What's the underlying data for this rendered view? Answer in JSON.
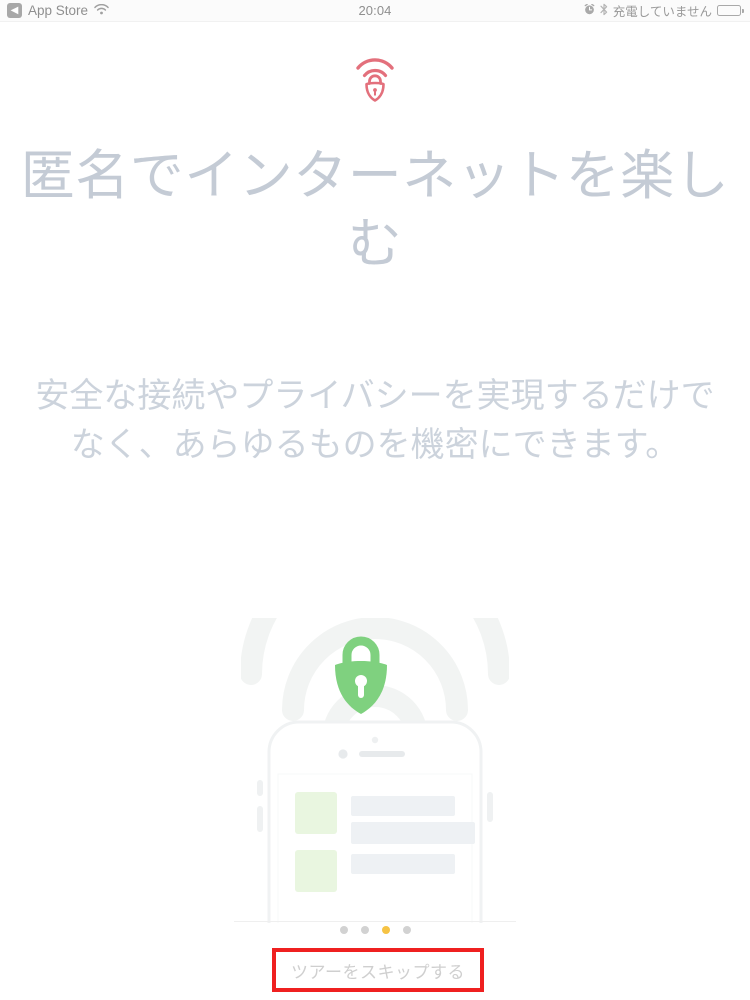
{
  "status_bar": {
    "back_label": "App Store",
    "back_icon": "chevron-left-icon",
    "wifi_icon": "wifi-icon",
    "time": "20:04",
    "alarm_icon": "alarm-clock-icon",
    "bluetooth_icon": "bluetooth-icon",
    "battery_text": "充電していません",
    "battery_icon": "battery-icon"
  },
  "brand": {
    "logo_icon": "wifi-lock-logo-icon",
    "logo_color": "#e3707c"
  },
  "content": {
    "headline": "匿名でインターネットを楽しむ",
    "headline_color": "#c4cbd5",
    "body": "安全な接続やプライバシーを実現するだけでなく、あらゆるものを機密にできます。",
    "body_color": "#ccd3dc"
  },
  "illustration": {
    "wifi_arcs_icon": "wifi-arcs-icon",
    "shield_lock_icon": "shield-padlock-icon",
    "shield_color": "#7fd17f",
    "phone_icon": "smartphone-icon",
    "screen_tile_color": "#e9f6e0",
    "screen_bar_color": "#eef1f4"
  },
  "pagination": {
    "total": 4,
    "active_index": 2,
    "active_color": "#f6c344",
    "inactive_color": "#d2d2d2"
  },
  "footer": {
    "skip_label": "ツアーをスキップする",
    "highlight_color": "#ef2020"
  }
}
